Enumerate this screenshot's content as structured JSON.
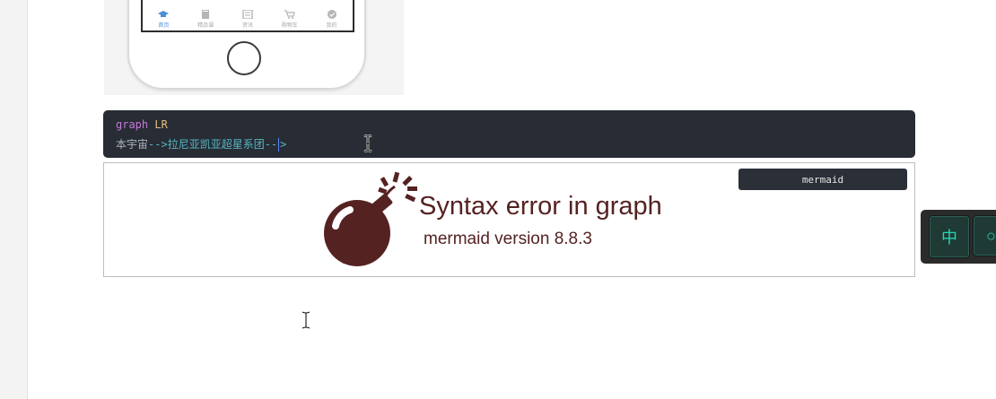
{
  "phone_tabs": [
    {
      "label": "首页",
      "icon": "graduation-cap-icon",
      "active": true
    },
    {
      "label": "精品课",
      "icon": "book-icon",
      "active": false
    },
    {
      "label": "资讯",
      "icon": "news-icon",
      "active": false
    },
    {
      "label": "购物车",
      "icon": "cart-icon",
      "active": false
    },
    {
      "label": "我的",
      "icon": "profile-check-icon",
      "active": false
    }
  ],
  "code": {
    "line1_keyword": "graph",
    "line1_direction": "LR",
    "line2_node1": "本宇宙",
    "line2_arrow1": "-->",
    "line2_node2": "拉尼亚凯亚超星系团",
    "line2_arrow2_a": "--",
    "line2_arrow2_b": ">"
  },
  "preview": {
    "language_tag": "mermaid",
    "error_title": "Syntax error in graph",
    "error_version": "mermaid version 8.8.3",
    "error_color": "#552222"
  },
  "ime": {
    "key1": "中",
    "key2": "○"
  },
  "colors": {
    "code_bg": "#282c34",
    "keyword": "#c678dd",
    "direction": "#e5c07b",
    "arrow": "#56b6c2",
    "ime_text": "#26d3b4"
  }
}
